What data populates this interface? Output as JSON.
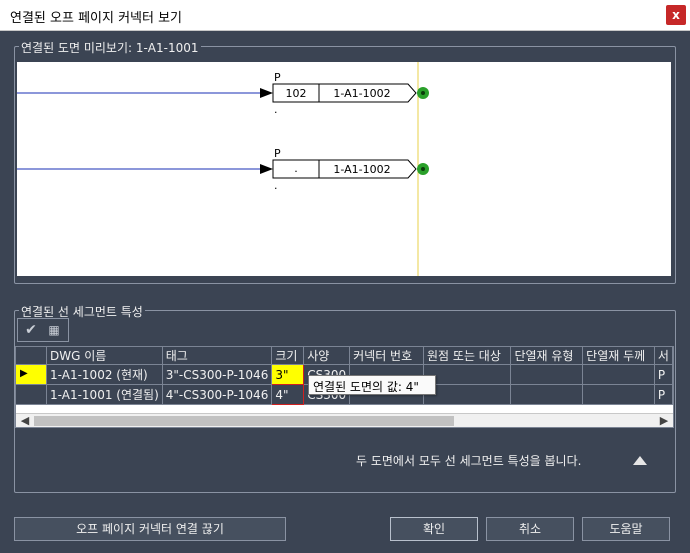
{
  "window": {
    "title": "연결된 오프 페이지 커넥터 보기",
    "close_label": "x"
  },
  "preview": {
    "label": "연결된 도면 미리보기: 1-A1-1001",
    "connectors": [
      {
        "tag": "P",
        "left_value": "102",
        "right_value": "1-A1-1002",
        "dot": "."
      },
      {
        "tag": "P",
        "left_value": ".",
        "right_value": "1-A1-1002",
        "dot": "."
      }
    ]
  },
  "segment": {
    "label": "연결된 선 세그먼트 특성",
    "toolbar": {
      "accept_icon": "checkmark-icon",
      "grid_icon": "grid-icon"
    },
    "columns": [
      "",
      "DWG 이름",
      "태그",
      "크기",
      "사양",
      "커넥터 번호",
      "원점 또는 대상",
      "단열재 유형",
      "단열재 두께",
      "서"
    ],
    "rows": [
      {
        "indicator": "▶",
        "dwg": "1-A1-1002 (현재)",
        "tag": "3\"-CS300-P-1046",
        "size": "3\"",
        "spec": "CS300",
        "last": "P"
      },
      {
        "indicator": "",
        "dwg": "1-A1-1001 (연결됨)",
        "tag": "4\"-CS300-P-1046",
        "size": "4\"",
        "spec": "CS300",
        "last": "P"
      }
    ],
    "tooltip": "연결된 도면의 값: 4\"",
    "info": "두 도면에서 모두 선 세그먼트 특성을 봅니다."
  },
  "buttons": {
    "disconnect": "오프 페이지 커넥터 연결 끊기",
    "ok": "확인",
    "cancel": "취소",
    "help": "도움말"
  },
  "colors": {
    "background": "#3b4453",
    "highlight": "#ffff00",
    "line": "#1a2fb5",
    "marker": "#2aa02a"
  }
}
